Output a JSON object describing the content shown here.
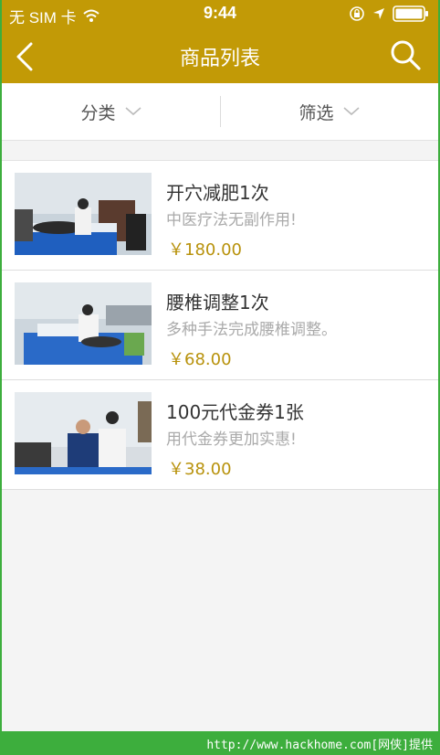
{
  "status_bar": {
    "carrier": "无 SIM 卡",
    "time": "9:44"
  },
  "nav": {
    "title": "商品列表"
  },
  "filters": [
    {
      "label": "分类"
    },
    {
      "label": "筛选"
    }
  ],
  "products": [
    {
      "title": "开穴减肥1次",
      "desc": "中医疗法无副作用!",
      "price": "￥180.00"
    },
    {
      "title": "腰椎调整1次",
      "desc": "多种手法完成腰椎调整。",
      "price": "￥68.00"
    },
    {
      "title": "100元代金券1张",
      "desc": "用代金券更加实惠!",
      "price": "￥38.00"
    }
  ],
  "footer": {
    "text": "http://www.hackhome.com[网侠]提供"
  },
  "colors": {
    "brand": "#c29a06",
    "price": "#b8920c",
    "footer": "#3dae3d"
  }
}
